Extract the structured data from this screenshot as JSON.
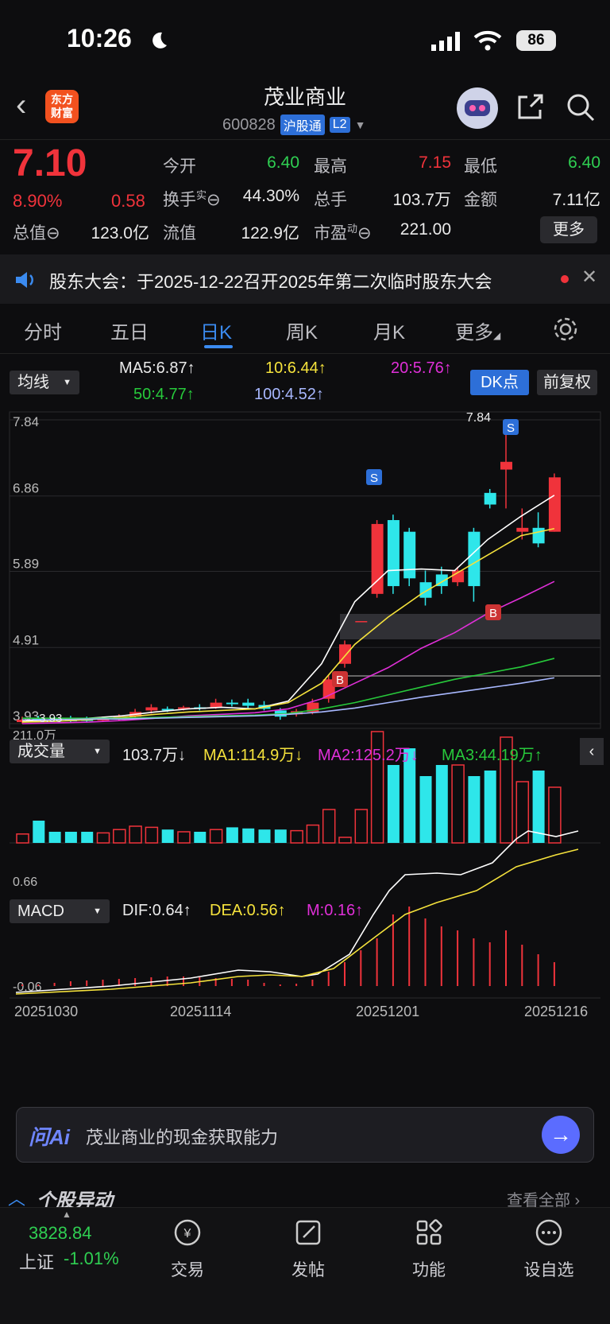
{
  "status_bar": {
    "time": "10:26",
    "battery": "86"
  },
  "header": {
    "logo_text": "东方财富",
    "stock_name": "茂业商业",
    "stock_code": "600828",
    "tag_hgt": "沪股通",
    "tag_level": "L2"
  },
  "quote": {
    "price": "7.10",
    "change_pct": "8.90%",
    "change": "0.58",
    "stats": [
      {
        "label": "今开",
        "value": "6.40",
        "color": "#2fcf52"
      },
      {
        "label": "最高",
        "value": "7.15",
        "color": "#f0333b"
      },
      {
        "label": "最低",
        "value": "6.40",
        "color": "#2fcf52"
      },
      {
        "label": "换手",
        "value": "44.30%",
        "color": "#eaeaea",
        "sup": "实"
      },
      {
        "label": "总手",
        "value": "103.7万",
        "color": "#eaeaea"
      },
      {
        "label": "金额",
        "value": "7.11亿",
        "color": "#eaeaea"
      },
      {
        "label": "总值",
        "value": "123.0亿",
        "color": "#eaeaea"
      },
      {
        "label": "流值",
        "value": "122.9亿",
        "color": "#eaeaea"
      },
      {
        "label": "市盈",
        "value": "221.00",
        "color": "#eaeaea",
        "sup": "动"
      }
    ],
    "more_label": "更多"
  },
  "notice": {
    "text": "股东大会：于2025-12-22召开2025年第二次临时股东大会"
  },
  "tabs": [
    "分时",
    "五日",
    "日K",
    "周K",
    "月K",
    "更多"
  ],
  "active_tab": "日K",
  "kline": {
    "indicator_select": "均线",
    "ma5": "MA5:6.87↑",
    "ma10": "10:6.44↑",
    "ma20": "20:5.76↑",
    "ma50": "50:4.77↑",
    "ma100": "100:4.52↑",
    "dk_label": "DK点",
    "fq_label": "前复权",
    "y_labels": [
      "7.84",
      "6.86",
      "5.89",
      "4.91",
      "3.93"
    ],
    "high_label": "7.84",
    "low_label": "3.93"
  },
  "volume": {
    "select": "成交量",
    "vol": "103.7万↓",
    "ma1": "MA1:114.9万↓",
    "ma2": "MA2:125.2万↓",
    "ma3": "MA3:44.19万↑",
    "max_label": "211.0万"
  },
  "macd": {
    "select": "MACD",
    "dif": "DIF:0.64↑",
    "dea": "DEA:0.56↑",
    "m": "M:0.16↑",
    "top_label": "0.66",
    "bottom_label": "-0.06"
  },
  "dates": [
    "20251030",
    "20251114",
    "20251201",
    "20251216"
  ],
  "colors": {
    "up": "#f0333b",
    "down": "#2ee6ea",
    "accent": "#2d6fd8"
  },
  "ai": {
    "logo": "问Ai",
    "prompt": "茂业商业的现金获取能力"
  },
  "movement": {
    "title": "个股异动",
    "view_all": "查看全部"
  },
  "bottom_nav": {
    "index_value": "3828.84",
    "index_name": "上证",
    "index_change": "-1.01%",
    "items": [
      "交易",
      "发帖",
      "功能",
      "设自选"
    ]
  }
}
